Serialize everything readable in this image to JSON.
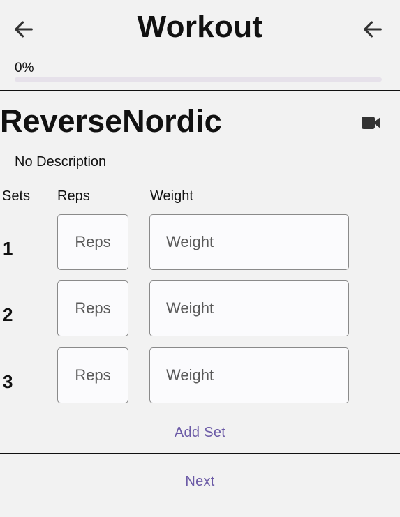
{
  "header": {
    "title": "Workout",
    "back_left_icon": "arrow-left-icon",
    "back_right_icon": "arrow-left-icon"
  },
  "progress": {
    "label": "0%",
    "value": 0
  },
  "exercise": {
    "name": "ReverseNordic",
    "video_icon": "video-camera-icon",
    "description": "No Description"
  },
  "table": {
    "headers": {
      "sets": "Sets",
      "reps": "Reps",
      "weight": "Weight"
    },
    "rows": [
      {
        "set": "1",
        "reps_placeholder": "Reps",
        "weight_placeholder": "Weight"
      },
      {
        "set": "2",
        "reps_placeholder": "Reps",
        "weight_placeholder": "Weight"
      },
      {
        "set": "3",
        "reps_placeholder": "Reps",
        "weight_placeholder": "Weight"
      }
    ]
  },
  "actions": {
    "add_set": "Add Set",
    "next": "Next"
  },
  "colors": {
    "accent": "#6b5aa6",
    "background": "#f2f2f2",
    "progress_track": "#e6e1ea"
  }
}
